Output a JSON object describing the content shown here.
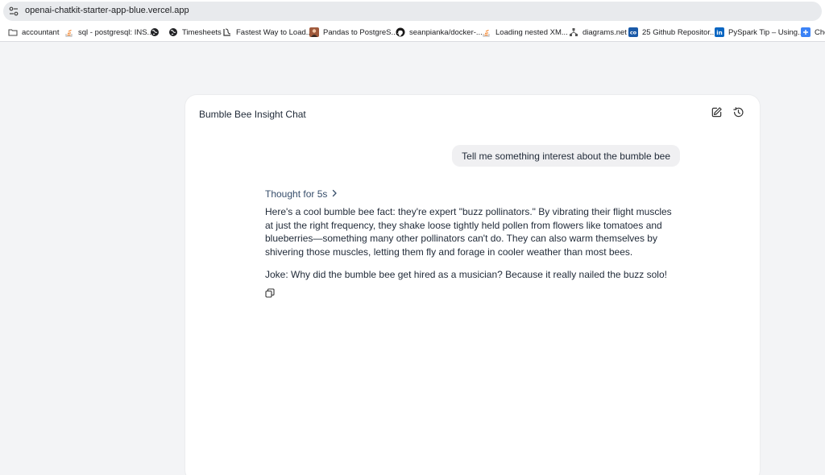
{
  "browser": {
    "url": "openai-chatkit-starter-app-blue.vercel.app",
    "site_info_icon": "tune-icon",
    "bookmarks": [
      {
        "label": "accountant",
        "icon": "folder-icon"
      },
      {
        "label": "sql - postgresql: INS...",
        "icon": "stack-overflow-icon"
      },
      {
        "label": "",
        "icon": "globe-icon"
      },
      {
        "label": "Timesheets",
        "icon": "globe-icon"
      },
      {
        "label": "Fastest Way to Load...",
        "icon": "site-icon"
      },
      {
        "label": "Pandas to PostgreS...",
        "icon": "avatar-icon"
      },
      {
        "label": "seanpianka/docker-...",
        "icon": "github-icon"
      },
      {
        "label": "Loading nested XM...",
        "icon": "stack-overflow-icon"
      },
      {
        "label": "diagrams.net",
        "icon": "diagrams-icon"
      },
      {
        "label": "25 Github Repositor...",
        "icon": "co-icon"
      },
      {
        "label": "PySpark Tip – Using...",
        "icon": "linkedin-icon"
      },
      {
        "label": "Che",
        "icon": "app-icon"
      }
    ]
  },
  "chat": {
    "title": "Bumble Bee Insight Chat",
    "header_buttons": [
      "edit-icon",
      "history-icon"
    ],
    "user_message": "Tell me something interest about the bumble bee",
    "thought_label": "Thought for 5s",
    "answer": "Here's a cool bumble bee fact: they're expert \"buzz pollinators.\" By vibrating their flight muscles at just the right frequency, they shake loose tightly held pollen from flowers like tomatoes and blueberries—something many other pollinators can't do. They can also warm themselves by shivering those muscles, letting them fly and forage in cooler weather than most bees.",
    "joke": "Joke: Why did the bumble bee get hired as a musician? Because it really nailed the buzz solo!",
    "copy_icon": "copy-icon"
  },
  "colors": {
    "page_bg": "#f3f4f6",
    "panel_bg": "#ffffff",
    "bubble_bg": "#f0f0f2",
    "thought_text": "#374e6b",
    "text": "#1f2937"
  }
}
